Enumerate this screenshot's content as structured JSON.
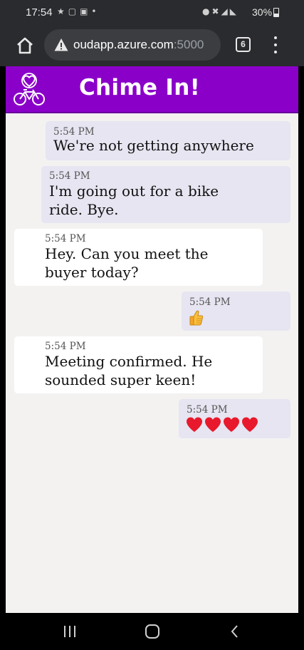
{
  "status_bar": {
    "time": "17:54",
    "battery": "30%"
  },
  "browser": {
    "url_host": "oudapp.azure.com",
    "url_port": ":5000",
    "tab_count": "6"
  },
  "app": {
    "title": "Chime In!",
    "accent_color": "#8a00c9"
  },
  "messages": [
    {
      "direction": "out",
      "time": "5:54 PM",
      "lines": [
        "We're not getting anywhere"
      ]
    },
    {
      "direction": "out",
      "time": "5:54 PM",
      "lines": [
        "I'm going out for a bike",
        "ride. Bye."
      ]
    },
    {
      "direction": "in",
      "time": "5:54 PM",
      "lines": [
        "Hey. Can you meet the",
        "buyer today?"
      ]
    },
    {
      "direction": "out",
      "time": "5:54 PM",
      "emoji": "thumbs-up",
      "lines": []
    },
    {
      "direction": "in",
      "time": "5:54 PM",
      "lines": [
        "Meeting confirmed. He",
        "sounded super keen!"
      ]
    },
    {
      "direction": "out",
      "time": "5:54 PM",
      "emoji": "four-red-hearts",
      "lines": []
    }
  ]
}
